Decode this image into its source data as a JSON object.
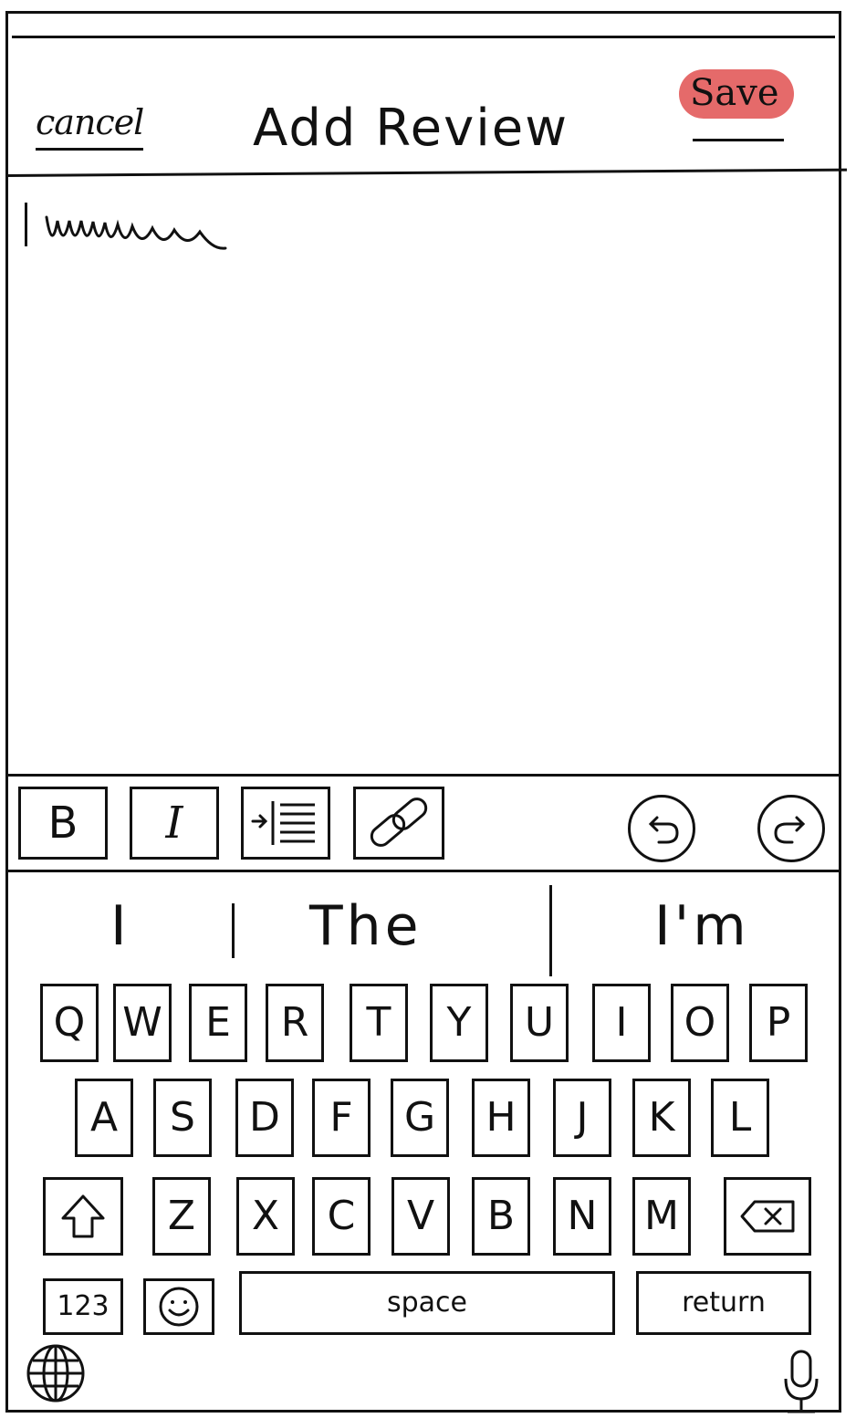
{
  "header": {
    "cancel_label": "cancel",
    "title": "Add Review",
    "save_label": "Save"
  },
  "colors": {
    "save_highlight": "#e56a6a",
    "ink": "#111111"
  },
  "toolbar": {
    "bold_label": "B",
    "italic_label": "I",
    "indent_icon": "indent-icon",
    "link_icon": "link-icon",
    "undo_icon": "undo-icon",
    "redo_icon": "redo-icon"
  },
  "suggestions": [
    "I",
    "The",
    "I'm"
  ],
  "keyboard": {
    "row1": [
      "Q",
      "W",
      "E",
      "R",
      "T",
      "Y",
      "U",
      "I",
      "O",
      "P"
    ],
    "row2": [
      "A",
      "S",
      "D",
      "F",
      "G",
      "H",
      "J",
      "K",
      "L"
    ],
    "row3": [
      "Z",
      "X",
      "C",
      "V",
      "B",
      "N",
      "M"
    ],
    "numbers_label": "123",
    "space_label": "space",
    "return_label": "return",
    "shift_icon": "shift-icon",
    "backspace_icon": "backspace-icon",
    "emoji_icon": "emoji-icon",
    "globe_icon": "globe-icon",
    "mic_icon": "microphone-icon"
  }
}
